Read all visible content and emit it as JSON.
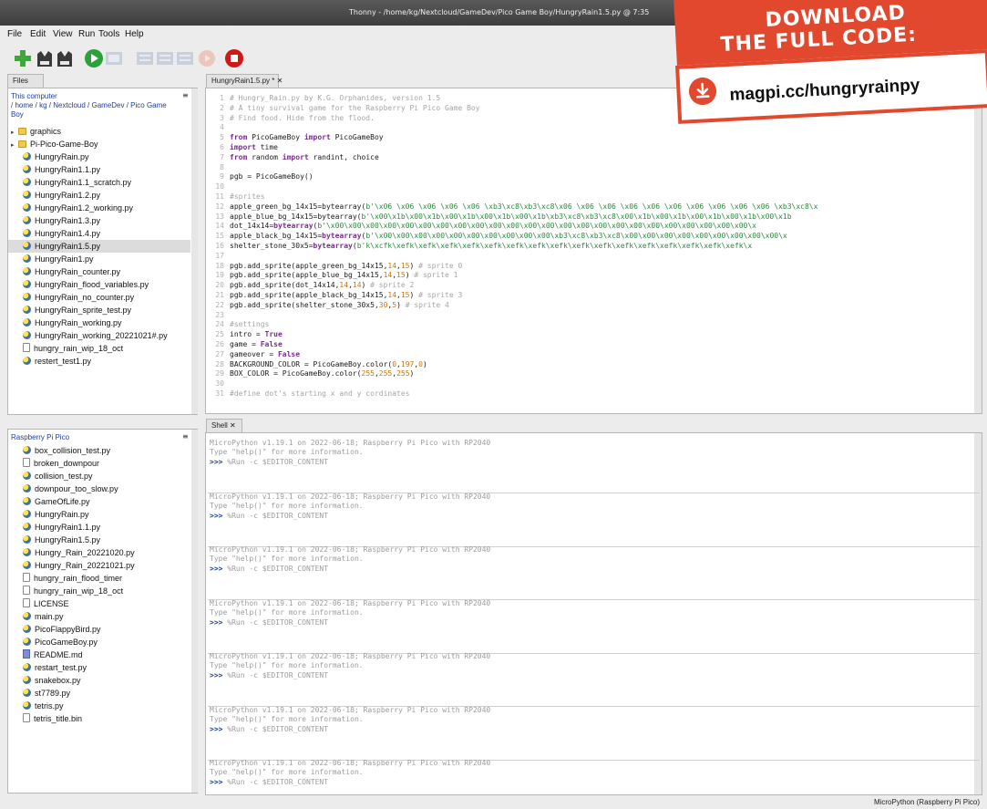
{
  "window": {
    "title": "Thonny - /home/kg/Nextcloud/GameDev/Pico Game Boy/HungryRain1.5.py @ 7:35"
  },
  "menu": [
    "File",
    "Edit",
    "View",
    "Run",
    "Tools",
    "Help"
  ],
  "toolbar": {
    "buttons": [
      "new-file",
      "open-file",
      "save-file",
      "run",
      "debug",
      "step-over",
      "step-into",
      "step-out",
      "resume",
      "stop"
    ],
    "colors": {
      "new": "#3ea63a",
      "run": "#2aa13a",
      "stop": "#d01818",
      "disabled": "#b9c3d3"
    }
  },
  "files_panel": {
    "tab": "Files",
    "computer": {
      "heading": "This computer",
      "path": "/ home / kg / Nextcloud / GameDev / Pico Game Boy",
      "items": [
        {
          "type": "folder",
          "name": "graphics"
        },
        {
          "type": "folder",
          "name": "Pi-Pico-Game-Boy"
        },
        {
          "type": "py",
          "name": "HungryRain.py"
        },
        {
          "type": "py",
          "name": "HungryRain1.1.py"
        },
        {
          "type": "py",
          "name": "HungryRain1.1_scratch.py"
        },
        {
          "type": "py",
          "name": "HungryRain1.2.py"
        },
        {
          "type": "py",
          "name": "HungryRain1.2_working.py"
        },
        {
          "type": "py",
          "name": "HungryRain1.3.py"
        },
        {
          "type": "py",
          "name": "HungryRain1.4.py"
        },
        {
          "type": "py",
          "name": "HungryRain1.5.py",
          "selected": true
        },
        {
          "type": "py",
          "name": "HungryRain1.py"
        },
        {
          "type": "py",
          "name": "HungryRain_counter.py"
        },
        {
          "type": "py",
          "name": "HungryRain_flood_variables.py"
        },
        {
          "type": "py",
          "name": "HungryRain_no_counter.py"
        },
        {
          "type": "py",
          "name": "HungryRain_sprite_test.py"
        },
        {
          "type": "py",
          "name": "HungryRain_working.py"
        },
        {
          "type": "py",
          "name": "HungryRain_working_20221021#.py"
        },
        {
          "type": "file",
          "name": "hungry_rain_wip_18_oct"
        },
        {
          "type": "py",
          "name": "restert_test1.py"
        }
      ]
    },
    "pico": {
      "heading": "Raspberry Pi Pico",
      "items": [
        {
          "type": "py",
          "name": "box_collision_test.py"
        },
        {
          "type": "file",
          "name": "broken_downpour"
        },
        {
          "type": "py",
          "name": "collision_test.py"
        },
        {
          "type": "py",
          "name": "downpour_too_slow.py"
        },
        {
          "type": "py",
          "name": "GameOfLife.py"
        },
        {
          "type": "py",
          "name": "HungryRain.py"
        },
        {
          "type": "py",
          "name": "HungryRain1.1.py"
        },
        {
          "type": "py",
          "name": "HungryRain1.5.py"
        },
        {
          "type": "py",
          "name": "Hungry_Rain_20221020.py"
        },
        {
          "type": "py",
          "name": "Hungry_Rain_20221021.py"
        },
        {
          "type": "file",
          "name": "hungry_rain_flood_timer"
        },
        {
          "type": "file",
          "name": "hungry_rain_wip_18_oct"
        },
        {
          "type": "file",
          "name": "LICENSE"
        },
        {
          "type": "py",
          "name": "main.py"
        },
        {
          "type": "py",
          "name": "PicoFlappyBird.py"
        },
        {
          "type": "py",
          "name": "PicoGameBoy.py"
        },
        {
          "type": "md",
          "name": "README.md"
        },
        {
          "type": "py",
          "name": "restart_test.py"
        },
        {
          "type": "py",
          "name": "snakebox.py"
        },
        {
          "type": "py",
          "name": "st7789.py"
        },
        {
          "type": "py",
          "name": "tetris.py"
        },
        {
          "type": "file",
          "name": "tetris_title.bin"
        }
      ]
    }
  },
  "editor": {
    "tab": "HungryRain1.5.py * ✕",
    "lines": [
      {
        "n": "1",
        "segs": [
          [
            "cm",
            "# Hungry_Rain.py by K.G. Orphanides, version 1.5"
          ]
        ]
      },
      {
        "n": "2",
        "segs": [
          [
            "cm",
            "# A tiny survival game for the Raspberry Pi Pico Game Boy"
          ]
        ]
      },
      {
        "n": "3",
        "segs": [
          [
            "cm",
            "# Find food. Hide from the flood."
          ]
        ]
      },
      {
        "n": "4",
        "segs": []
      },
      {
        "n": "5",
        "segs": [
          [
            "kw",
            "from"
          ],
          [
            "pl",
            " PicoGameBoy "
          ],
          [
            "kw",
            "import"
          ],
          [
            "pl",
            " PicoGameBoy"
          ]
        ]
      },
      {
        "n": "6",
        "segs": [
          [
            "kw",
            "import"
          ],
          [
            "pl",
            " time"
          ]
        ]
      },
      {
        "n": "7",
        "segs": [
          [
            "kw",
            "from"
          ],
          [
            "pl",
            " random "
          ],
          [
            "kw",
            "import"
          ],
          [
            "pl",
            " randint, choice"
          ]
        ]
      },
      {
        "n": "8",
        "segs": []
      },
      {
        "n": "9",
        "segs": [
          [
            "pl",
            "pgb = PicoGameBoy()"
          ]
        ]
      },
      {
        "n": "10",
        "segs": []
      },
      {
        "n": "11",
        "segs": [
          [
            "cm",
            "#sprites"
          ]
        ]
      },
      {
        "n": "12",
        "segs": [
          [
            "pl",
            "apple_green_bg_14x15=bytearray("
          ],
          [
            "bt",
            "b'\\x06 \\x06 \\x06 \\x06 \\x06 \\xb3\\xc8\\xb3\\xc8\\x06 \\x06 \\x06 \\x06 \\x06 \\x06 \\x06 \\x06 \\x06 \\x06 \\xb3\\xc8\\x"
          ]
        ]
      },
      {
        "n": "13",
        "segs": [
          [
            "pl",
            "apple_blue_bg_14x15=bytearray("
          ],
          [
            "bt",
            "b'\\x00\\x1b\\x00\\x1b\\x00\\x1b\\x00\\x1b\\x00\\x1b\\xb3\\xc8\\xb3\\xc8\\x00\\x1b\\x00\\x1b\\x00\\x1b\\x00\\x1b\\x00\\x1b"
          ]
        ]
      },
      {
        "n": "14",
        "segs": [
          [
            "pl",
            "dot_14x14="
          ],
          [
            "kw",
            "bytearray"
          ],
          [
            "pl",
            "("
          ],
          [
            "bt",
            "b'\\x00\\x00\\x00\\x00\\x00\\x00\\x00\\x00\\x00\\x00\\x00\\x00\\x00\\x00\\x00\\x00\\x00\\x00\\x00\\x00\\x00\\x00\\x00\\x00\\x"
          ]
        ]
      },
      {
        "n": "15",
        "segs": [
          [
            "pl",
            "apple_black_bg_14x15="
          ],
          [
            "kw",
            "bytearray"
          ],
          [
            "pl",
            "("
          ],
          [
            "bt",
            "b'\\x00\\x00\\x00\\x00\\x00\\x00\\x00\\x00\\x00\\x00\\xb3\\xc8\\xb3\\xc8\\x00\\x00\\x00\\x00\\x00\\x00\\x00\\x00\\x00\\x"
          ]
        ]
      },
      {
        "n": "16",
        "segs": [
          [
            "pl",
            "shelter_stone_30x5="
          ],
          [
            "kw",
            "bytearray"
          ],
          [
            "pl",
            "("
          ],
          [
            "bt",
            "b'k\\xcfk\\xefk\\xefk\\xefk\\xefk\\xefk\\xefk\\xefk\\xefk\\xefk\\xefk\\xefk\\xefk\\xefk\\xefk\\xefk\\xefk\\x"
          ]
        ]
      },
      {
        "n": "17",
        "segs": []
      },
      {
        "n": "18",
        "segs": [
          [
            "pl",
            "pgb.add_sprite(apple_green_bg_14x15,"
          ],
          [
            "nu",
            "14"
          ],
          [
            "pl",
            ","
          ],
          [
            "nu",
            "15"
          ],
          [
            "pl",
            ") "
          ],
          [
            "cm",
            "# sprite 0"
          ]
        ]
      },
      {
        "n": "19",
        "segs": [
          [
            "pl",
            "pgb.add_sprite(apple_blue_bg_14x15,"
          ],
          [
            "nu",
            "14"
          ],
          [
            "pl",
            ","
          ],
          [
            "nu",
            "15"
          ],
          [
            "pl",
            ") "
          ],
          [
            "cm",
            "# sprite 1"
          ]
        ]
      },
      {
        "n": "20",
        "segs": [
          [
            "pl",
            "pgb.add_sprite(dot_14x14,"
          ],
          [
            "nu",
            "14"
          ],
          [
            "pl",
            ","
          ],
          [
            "nu",
            "14"
          ],
          [
            "pl",
            ") "
          ],
          [
            "cm",
            "# sprite 2"
          ]
        ]
      },
      {
        "n": "21",
        "segs": [
          [
            "pl",
            "pgb.add_sprite(apple_black_bg_14x15,"
          ],
          [
            "nu",
            "14"
          ],
          [
            "pl",
            ","
          ],
          [
            "nu",
            "15"
          ],
          [
            "pl",
            ") "
          ],
          [
            "cm",
            "# sprite 3"
          ]
        ]
      },
      {
        "n": "22",
        "segs": [
          [
            "pl",
            "pgb.add_sprite(shelter_stone_30x5,"
          ],
          [
            "nu",
            "30"
          ],
          [
            "pl",
            ","
          ],
          [
            "nu",
            "5"
          ],
          [
            "pl",
            ") "
          ],
          [
            "cm",
            "# sprite 4"
          ]
        ]
      },
      {
        "n": "23",
        "segs": []
      },
      {
        "n": "24",
        "segs": [
          [
            "cm",
            "#settings"
          ]
        ]
      },
      {
        "n": "25",
        "segs": [
          [
            "pl",
            "intro = "
          ],
          [
            "kw",
            "True"
          ]
        ]
      },
      {
        "n": "26",
        "segs": [
          [
            "pl",
            "game = "
          ],
          [
            "kw",
            "False"
          ]
        ]
      },
      {
        "n": "27",
        "segs": [
          [
            "pl",
            "gameover = "
          ],
          [
            "kw",
            "False"
          ]
        ]
      },
      {
        "n": "28",
        "segs": [
          [
            "pl",
            "BACKGROUND_COLOR = PicoGameBoy.color("
          ],
          [
            "nu",
            "0"
          ],
          [
            "pl",
            ","
          ],
          [
            "nu",
            "197"
          ],
          [
            "pl",
            ","
          ],
          [
            "nu",
            "0"
          ],
          [
            "pl",
            ")"
          ]
        ]
      },
      {
        "n": "29",
        "segs": [
          [
            "pl",
            "BOX_COLOR = PicoGameBoy.color("
          ],
          [
            "nu",
            "255"
          ],
          [
            "pl",
            ","
          ],
          [
            "nu",
            "255"
          ],
          [
            "pl",
            ","
          ],
          [
            "nu",
            "255"
          ],
          [
            "pl",
            ")"
          ]
        ]
      },
      {
        "n": "30",
        "segs": []
      },
      {
        "n": "31",
        "segs": [
          [
            "cm",
            "#define dot's starting x and y cordinates"
          ]
        ]
      }
    ]
  },
  "shell": {
    "tab": "Shell ✕",
    "sessions": [
      {
        "banner": "MicroPython v1.19.1 on 2022-06-18; Raspberry Pi Pico with RP2040",
        "help": "Type \"help()\" for more information.",
        "prompt": ">>>",
        "cmd": " %Run -c $EDITOR_CONTENT"
      },
      {
        "banner": "MicroPython v1.19.1 on 2022-06-18; Raspberry Pi Pico with RP2040",
        "help": "Type \"help()\" for more information.",
        "prompt": ">>>",
        "cmd": " %Run -c $EDITOR_CONTENT"
      },
      {
        "banner": "MicroPython v1.19.1 on 2022-06-18; Raspberry Pi Pico with RP2040",
        "help": "Type \"help()\" for more information.",
        "prompt": ">>>",
        "cmd": " %Run -c $EDITOR_CONTENT"
      },
      {
        "banner": "MicroPython v1.19.1 on 2022-06-18; Raspberry Pi Pico with RP2040",
        "help": "Type \"help()\" for more information.",
        "prompt": ">>>",
        "cmd": " %Run -c $EDITOR_CONTENT"
      },
      {
        "banner": "MicroPython v1.19.1 on 2022-06-18; Raspberry Pi Pico with RP2040",
        "help": "Type \"help()\" for more information.",
        "prompt": ">>>",
        "cmd": " %Run -c $EDITOR_CONTENT"
      },
      {
        "banner": "MicroPython v1.19.1 on 2022-06-18; Raspberry Pi Pico with RP2040",
        "help": "Type \"help()\" for more information.",
        "prompt": ">>>",
        "cmd": " %Run -c $EDITOR_CONTENT"
      },
      {
        "banner": "MicroPython v1.19.1 on 2022-06-18; Raspberry Pi Pico with RP2040",
        "help": "Type \"help()\" for more information.",
        "prompt": ">>>",
        "cmd": " %Run -c $EDITOR_CONTENT"
      }
    ]
  },
  "status": {
    "interpreter": "MicroPython (Raspberry Pi Pico)"
  },
  "banner": {
    "line1": "DOWNLOAD",
    "line2": "THE FULL CODE:",
    "url": "magpi.cc/hungryrainpy",
    "accent": "#e1482e"
  }
}
